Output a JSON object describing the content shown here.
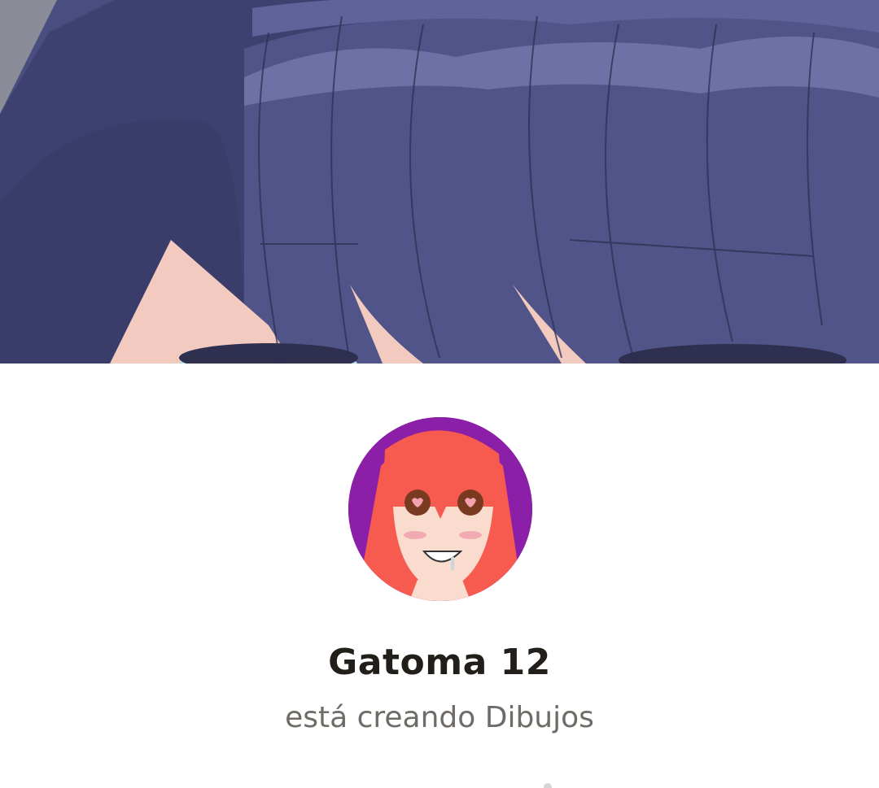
{
  "banner": {
    "image": "anime-character-bangs-closeup-banner",
    "colors": {
      "hair": "#4f5286",
      "hair_shadow": "#3d4170",
      "highlight": "#6f6fa4",
      "skin": "#f1c9bf",
      "eye": "#aee0ea"
    }
  },
  "creator": {
    "avatar": "red-haired-anime-girl-heart-eyes-avatar",
    "name": "Gatoma 12",
    "tagline": "está creando Dibujos"
  },
  "colors": {
    "name_text": "#221e1a",
    "tagline_text": "#6f6b66",
    "background": "#ffffff"
  }
}
